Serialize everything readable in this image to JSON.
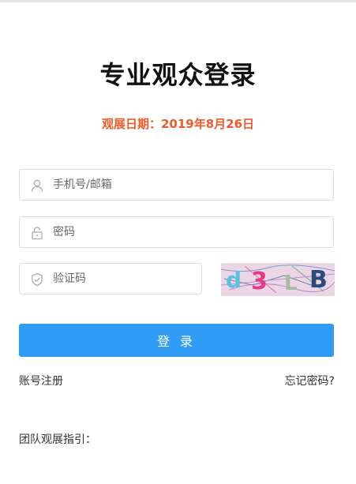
{
  "title": "专业观众登录",
  "date_line": "观展日期：2019年8月26日",
  "form": {
    "username_placeholder": "手机号/邮箱",
    "password_placeholder": "密码",
    "captcha_placeholder": "验证码",
    "captcha_chars": [
      "d",
      "3",
      "L",
      "B"
    ]
  },
  "login_button": "登 录",
  "register_link": "账号注册",
  "forgot_link": "忘记密码?",
  "guide_heading": "团队观展指引：",
  "colors": {
    "accent": "#2f9cf5",
    "date_text": "#f05a28",
    "captcha_bg": "#ead6e4"
  }
}
